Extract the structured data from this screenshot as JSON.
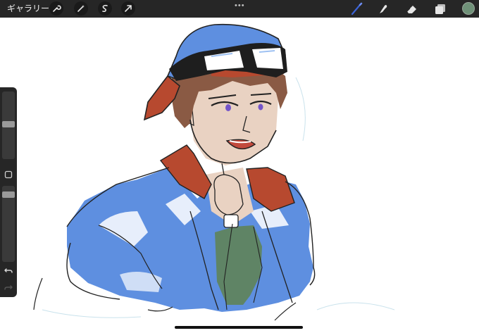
{
  "topbar": {
    "gallery_label": "ギャラリー",
    "left_tools": [
      {
        "icon": "wrench-icon"
      },
      {
        "icon": "magic-wand-icon"
      },
      {
        "icon": "selection-icon"
      },
      {
        "icon": "transform-arrow-icon"
      }
    ],
    "more_label": "•••",
    "right_tools": [
      {
        "icon": "brush-icon",
        "active": true
      },
      {
        "icon": "smudge-icon"
      },
      {
        "icon": "eraser-icon"
      },
      {
        "icon": "layers-icon"
      }
    ],
    "color_swatch": "#6f9178"
  },
  "sidebar": {
    "brush_size_level": 0.2,
    "opacity_level": 0.05,
    "modify_icon": "square-icon",
    "undo_icon": "undo-icon",
    "redo_icon": "redo-icon"
  },
  "colors": {
    "bar": "#262626",
    "accent_blue": "#3b63d6",
    "jacket_blue": "#5e8fe0",
    "collar_red": "#b7492f",
    "shirt_green": "#5f8465",
    "skin": "#e9d2c2",
    "hair": "#8a5a44"
  }
}
